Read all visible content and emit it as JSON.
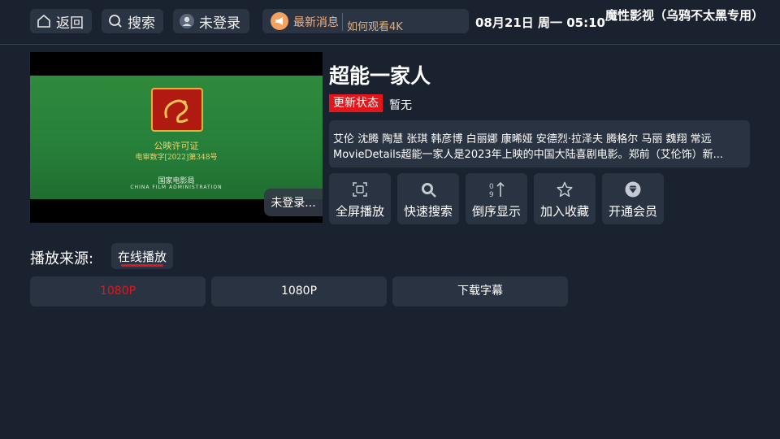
{
  "topbar": {
    "back_label": "返回",
    "search_label": "搜索",
    "login_label": "未登录",
    "news_label": "最新消息",
    "news_text": "如何观看4K",
    "datetime": "08月21日 周一 05:10",
    "app_title": "魔性影视（乌鸦不太黑专用）"
  },
  "player": {
    "cert_line1": "公映许可证",
    "cert_line2": "电审数字[2022]第348号",
    "cert_line3": "国家电影局",
    "cert_line4": "CHINA FILM ADMINISTRATION",
    "login_overlay": "未登录..."
  },
  "movie": {
    "title": "超能一家人",
    "status_badge": "更新状态",
    "status_value": "暂无",
    "cast": "艾伦 沈腾 陶慧 张琪 韩彦博 白丽娜 康晞娅 安德烈·拉泽夫 腾格尔 马丽 魏翔 常远",
    "description": "MovieDetails超能一家人是2023年上映的中国大陆喜剧电影。郑前（艾伦饰）新..."
  },
  "actions": [
    {
      "label": "全屏播放",
      "icon": "fullscreen-icon"
    },
    {
      "label": "快速搜索",
      "icon": "search-icon"
    },
    {
      "label": "倒序显示",
      "icon": "sort-icon"
    },
    {
      "label": "加入收藏",
      "icon": "star-icon"
    },
    {
      "label": "开通会员",
      "icon": "vip-diamond-icon"
    }
  ],
  "source": {
    "label": "播放来源:",
    "tab": "在线播放"
  },
  "episodes": [
    {
      "label": "1080P",
      "color": "#e3171b"
    },
    {
      "label": "1080P",
      "color": "#ffffff"
    },
    {
      "label": "下载字幕",
      "color": "#ffffff"
    }
  ],
  "colors": {
    "background": "#1a2230",
    "panel": "#2a3341",
    "accent_red": "#e3171b",
    "news_orange": "#f4a261"
  }
}
